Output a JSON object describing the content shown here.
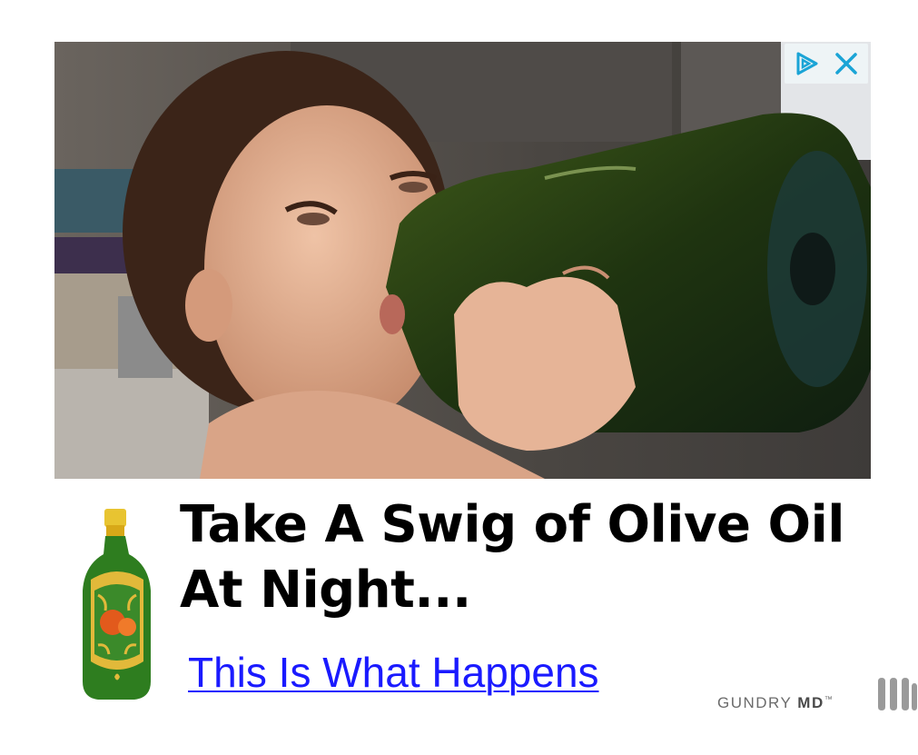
{
  "ad": {
    "headline": "Take A Swig of Olive Oil At Night...",
    "subline": "This Is What Happens",
    "brand_name": "GUNDRY",
    "brand_suffix": "MD",
    "brand_tm": "™"
  },
  "icons": {
    "adchoices": "adchoices-play-icon",
    "close": "close-icon",
    "network": "ad-network-logo-icon",
    "bottle": "olive-oil-bottle-icon"
  },
  "colors": {
    "headline": "#000000",
    "link": "#1a1aff",
    "adchoices": "#1aa4d6",
    "bottle_green": "#2e7d1f",
    "bottle_cap": "#e8c431"
  }
}
